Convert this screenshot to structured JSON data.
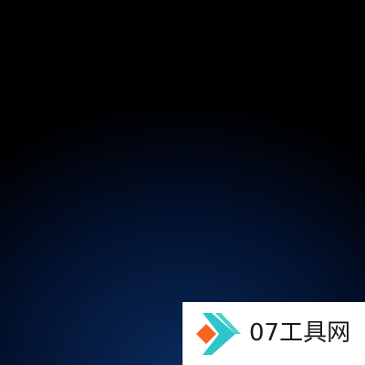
{
  "watermark": {
    "text": "07工具网",
    "logo_icon": "diamond-arrow-logo-icon",
    "colors": {
      "accent_cyan": "#2ec6c9",
      "accent_orange": "#f26522",
      "background": "#ffffff"
    }
  },
  "background": {
    "style": "dark blue radial gradient",
    "colors": [
      "#000000",
      "#0a2a5c"
    ]
  }
}
